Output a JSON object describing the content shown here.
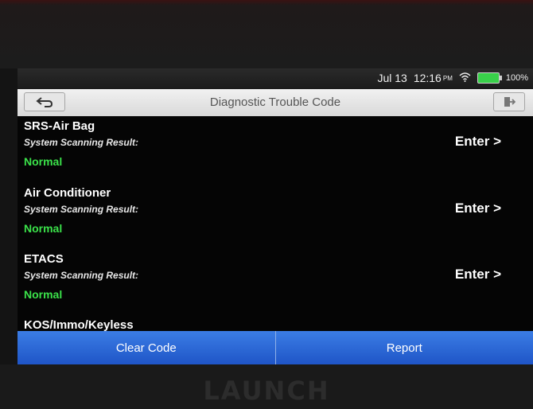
{
  "status_bar": {
    "date": "Jul 13",
    "time": "12:16",
    "ampm": "PM",
    "battery": "100%",
    "wifi_icon": "wifi-icon",
    "battery_icon": "battery-icon",
    "battery_color": "#39d14a"
  },
  "header": {
    "title": "Diagnostic Trouble Code",
    "back_icon": "back-arrow-icon",
    "exit_icon": "exit-icon"
  },
  "systems": [
    {
      "name": "SRS-Air Bag",
      "label": "System Scanning Result:",
      "status": "Normal",
      "action": "Enter >"
    },
    {
      "name": "Air Conditioner",
      "label": "System Scanning Result:",
      "status": "Normal",
      "action": "Enter >"
    },
    {
      "name": "ETACS",
      "label": "System Scanning Result:",
      "status": "Normal",
      "action": "Enter >"
    },
    {
      "name": "KOS/Immo/Keyless"
    }
  ],
  "footer": {
    "clear_code": "Clear Code",
    "report": "Report"
  },
  "device": {
    "brand": "LAUNCH"
  },
  "colors": {
    "status_normal": "#3be24a",
    "button_blue": "#2a66d6"
  }
}
